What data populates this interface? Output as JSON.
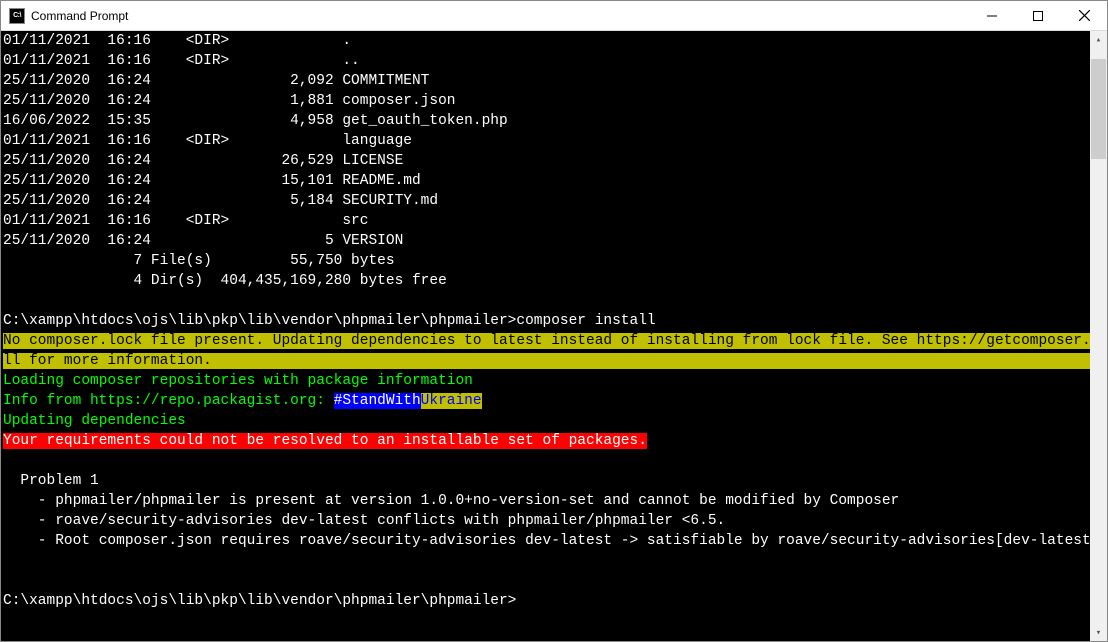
{
  "window": {
    "title": "Command Prompt",
    "icon_label": "C:\\"
  },
  "dir_listing": [
    {
      "date": "01/11/2021",
      "time": "16:16",
      "dir": "<DIR>",
      "size": "",
      "name": "."
    },
    {
      "date": "01/11/2021",
      "time": "16:16",
      "dir": "<DIR>",
      "size": "",
      "name": ".."
    },
    {
      "date": "25/11/2020",
      "time": "16:24",
      "dir": "",
      "size": "2,092",
      "name": "COMMITMENT"
    },
    {
      "date": "25/11/2020",
      "time": "16:24",
      "dir": "",
      "size": "1,881",
      "name": "composer.json"
    },
    {
      "date": "16/06/2022",
      "time": "15:35",
      "dir": "",
      "size": "4,958",
      "name": "get_oauth_token.php"
    },
    {
      "date": "01/11/2021",
      "time": "16:16",
      "dir": "<DIR>",
      "size": "",
      "name": "language"
    },
    {
      "date": "25/11/2020",
      "time": "16:24",
      "dir": "",
      "size": "26,529",
      "name": "LICENSE"
    },
    {
      "date": "25/11/2020",
      "time": "16:24",
      "dir": "",
      "size": "15,101",
      "name": "README.md"
    },
    {
      "date": "25/11/2020",
      "time": "16:24",
      "dir": "",
      "size": "5,184",
      "name": "SECURITY.md"
    },
    {
      "date": "01/11/2021",
      "time": "16:16",
      "dir": "<DIR>",
      "size": "",
      "name": "src"
    },
    {
      "date": "25/11/2020",
      "time": "16:24",
      "dir": "",
      "size": "5",
      "name": "VERSION"
    }
  ],
  "summary": {
    "files_line": "               7 File(s)         55,750 bytes",
    "dirs_line": "               4 Dir(s)  404,435,169,280 bytes free"
  },
  "prompt1": {
    "path": "C:\\xampp\\htdocs\\ojs\\lib\\pkp\\lib\\vendor\\phpmailer\\phpmailer>",
    "command": "composer install"
  },
  "composer": {
    "warn": "No composer.lock file present. Updating dependencies to latest instead of installing from lock file. See https://getcomposer.org/install for more information.",
    "loading": "Loading composer repositories with package information",
    "info_prefix": "Info from https://repo.packagist.org: ",
    "stand_with": "#StandWith",
    "ukraine": "Ukraine",
    "updating": "Updating dependencies",
    "error": "Your requirements could not be resolved to an installable set of packages."
  },
  "problem": {
    "header": "  Problem 1",
    "line1": "    - phpmailer/phpmailer is present at version 1.0.0+no-version-set and cannot be modified by Composer",
    "line2": "    - roave/security-advisories dev-latest conflicts with phpmailer/phpmailer <6.5.",
    "line3": "    - Root composer.json requires roave/security-advisories dev-latest -> satisfiable by roave/security-advisories[dev-latest]."
  },
  "prompt2": {
    "path": "C:\\xampp\\htdocs\\ojs\\lib\\pkp\\lib\\vendor\\phpmailer\\phpmailer>"
  }
}
